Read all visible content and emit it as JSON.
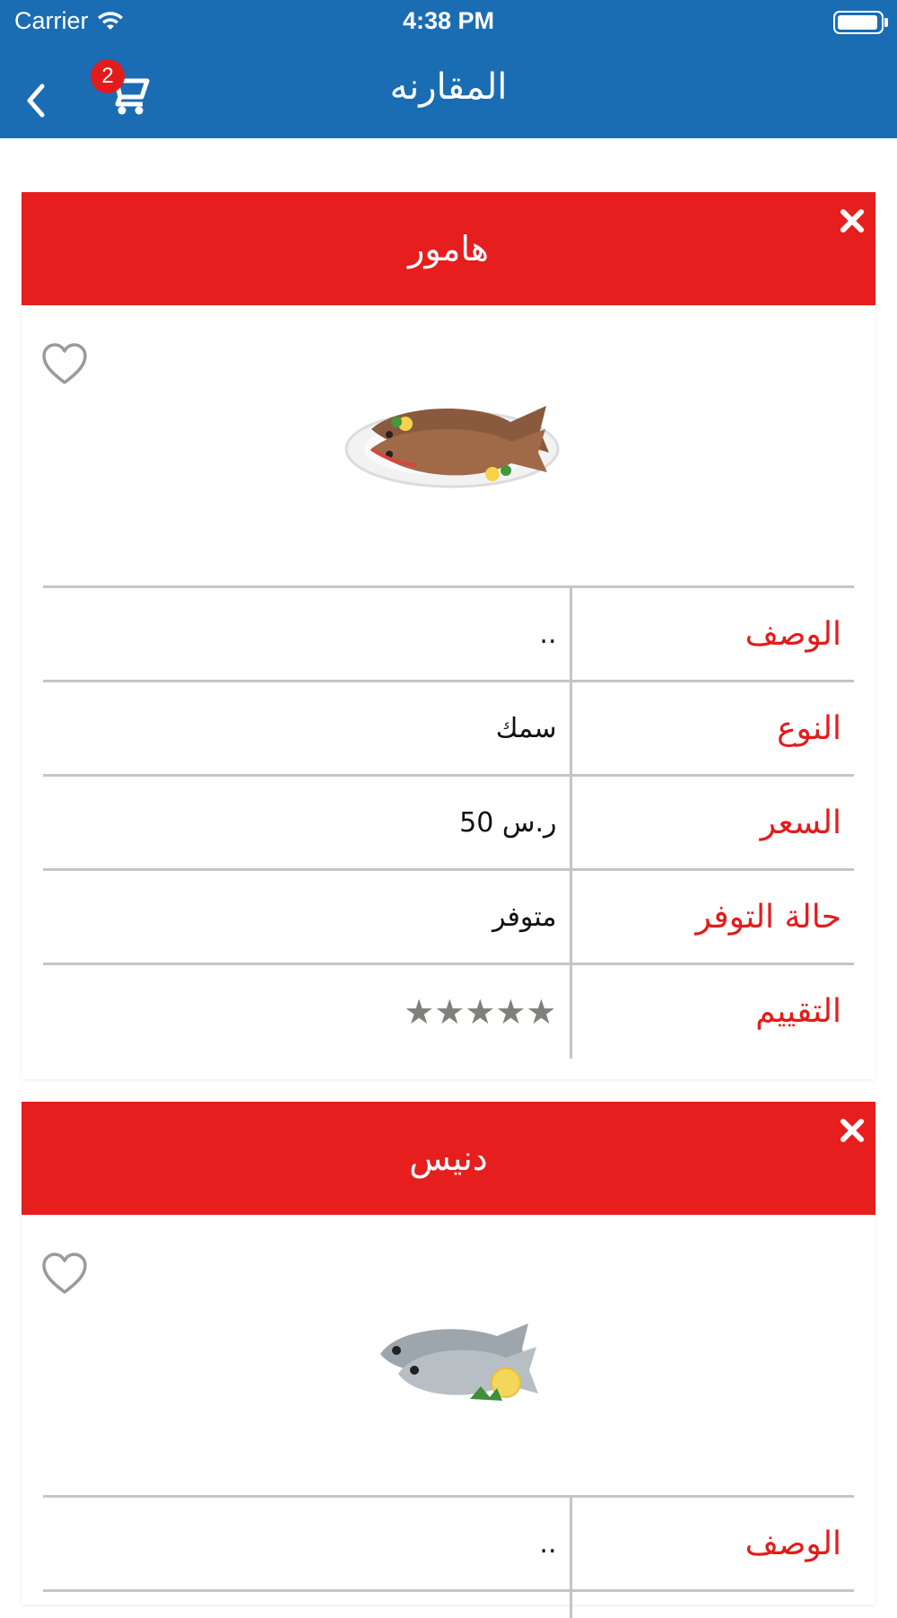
{
  "status_bar": {
    "carrier": "Carrier",
    "time": "4:38 PM"
  },
  "header": {
    "title": "المقارنه",
    "cart_count": "2",
    "colors": {
      "bar": "#1a6db3",
      "badge": "#e21c1c"
    }
  },
  "cards": [
    {
      "name": "هامور",
      "image": "grouper-fish-on-plate",
      "rows": [
        {
          "label": "الوصف",
          "value": ".."
        },
        {
          "label": "النوع",
          "value": "سمك"
        },
        {
          "label": "السعر",
          "value": "ر.س 50"
        },
        {
          "label": "حالة التوفر",
          "value": "متوفر"
        },
        {
          "label": "التقييم",
          "value": "★★★★★"
        }
      ]
    },
    {
      "name": "دنيس",
      "image": "sea-bream-fish-with-lemon",
      "rows": [
        {
          "label": "الوصف",
          "value": ".."
        }
      ]
    }
  ],
  "icons": {
    "back": "chevron-left-icon",
    "cart": "cart-icon",
    "remove": "close-icon",
    "favorite": "heart-outline-icon",
    "wifi": "wifi-icon",
    "battery": "battery-icon"
  }
}
